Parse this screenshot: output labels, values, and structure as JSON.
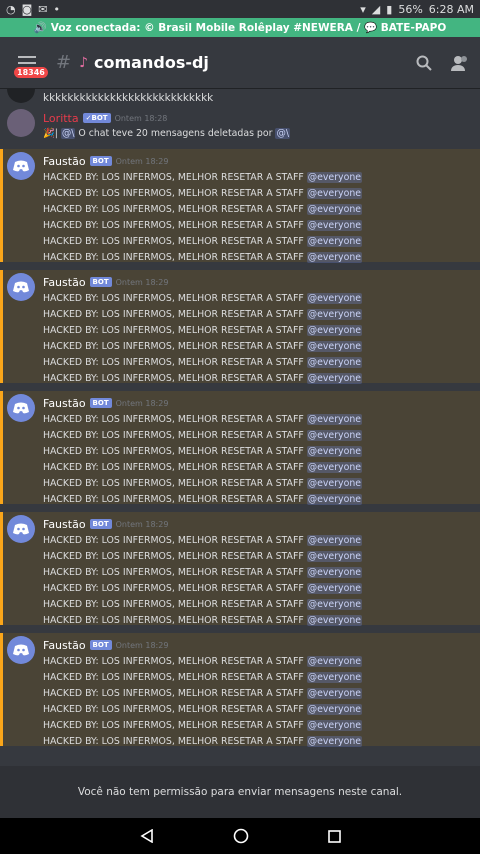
{
  "status": {
    "battery": "56%",
    "time": "6:28 AM"
  },
  "voice": {
    "text": "Voz conectada: © Brasil Mobile Rolêplay #NEWERA / 💬 BATE-PAPO"
  },
  "header": {
    "badge": "18346",
    "channel": "comandos-dj"
  },
  "first_line": "kkkkkkkkkkkkkkkkkkkkkkkkkkkk",
  "loritta": {
    "name": "Loritta",
    "badge": "✓BOT",
    "time": "Ontem 18:28",
    "text_a": "| ",
    "mention_a": "@\\",
    "text_b": " O chat teve 20 mensagens deletadas por ",
    "mention_b": "@\\"
  },
  "spam": {
    "name": "Faustão",
    "badge": "BOT",
    "time": "Ontem 18:29",
    "line": "HACKED BY: LOS INFERMOS, MELHOR RESETAR A STAFF ",
    "mention": "@everyone"
  },
  "footer": {
    "text": "Você não tem permissão para enviar mensagens neste canal."
  }
}
